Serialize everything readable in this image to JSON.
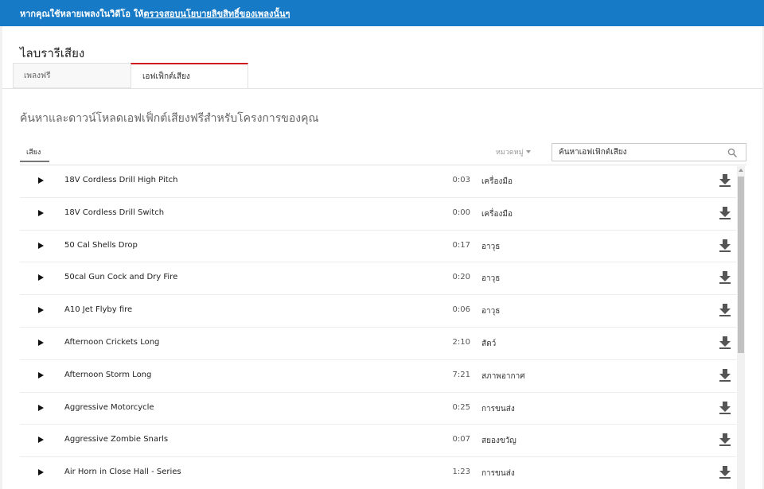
{
  "banner": {
    "text": "หากคุณใช้หลายเพลงในวิดีโอ ให้",
    "link": "ตรวจสอบนโยบายลิขสิทธิ์ของเพลงนั้นๆ"
  },
  "library": {
    "title": "ไลบรารีเสียง",
    "tabs": [
      {
        "label": "เพลงฟรี",
        "selected": false
      },
      {
        "label": "เอฟเฟ็กต์เสียง",
        "selected": true
      }
    ],
    "subtitle": "ค้นหาและดาวน์โหลดเอฟเฟ็กต์เสียงฟรีสำหรับโครงการของคุณ"
  },
  "filters": {
    "sound_tab": "เสียง",
    "category_label": "หมวดหมู่",
    "search_placeholder": "ค้นหาเอฟเฟ็กต์เสียง"
  },
  "colors": {
    "banner_bg": "#167ac6",
    "active_tab_accent": "#cc181e"
  },
  "tracks": [
    {
      "name": "18V Cordless Drill High Pitch",
      "duration": "0:03",
      "category": "เครื่องมือ"
    },
    {
      "name": "18V Cordless Drill Switch",
      "duration": "0:00",
      "category": "เครื่องมือ"
    },
    {
      "name": "50 Cal Shells Drop",
      "duration": "0:17",
      "category": "อาวุธ"
    },
    {
      "name": "50cal Gun Cock and Dry Fire",
      "duration": "0:20",
      "category": "อาวุธ"
    },
    {
      "name": "A10 Jet Flyby fire",
      "duration": "0:06",
      "category": "อาวุธ"
    },
    {
      "name": "Afternoon Crickets Long",
      "duration": "2:10",
      "category": "สัตว์"
    },
    {
      "name": "Afternoon Storm Long",
      "duration": "7:21",
      "category": "สภาพอากาศ"
    },
    {
      "name": "Aggressive Motorcycle",
      "duration": "0:25",
      "category": "การขนส่ง"
    },
    {
      "name": "Aggressive Zombie Snarls",
      "duration": "0:07",
      "category": "สยองขวัญ"
    },
    {
      "name": "Air Horn in Close Hall - Series",
      "duration": "1:23",
      "category": "การขนส่ง"
    }
  ]
}
